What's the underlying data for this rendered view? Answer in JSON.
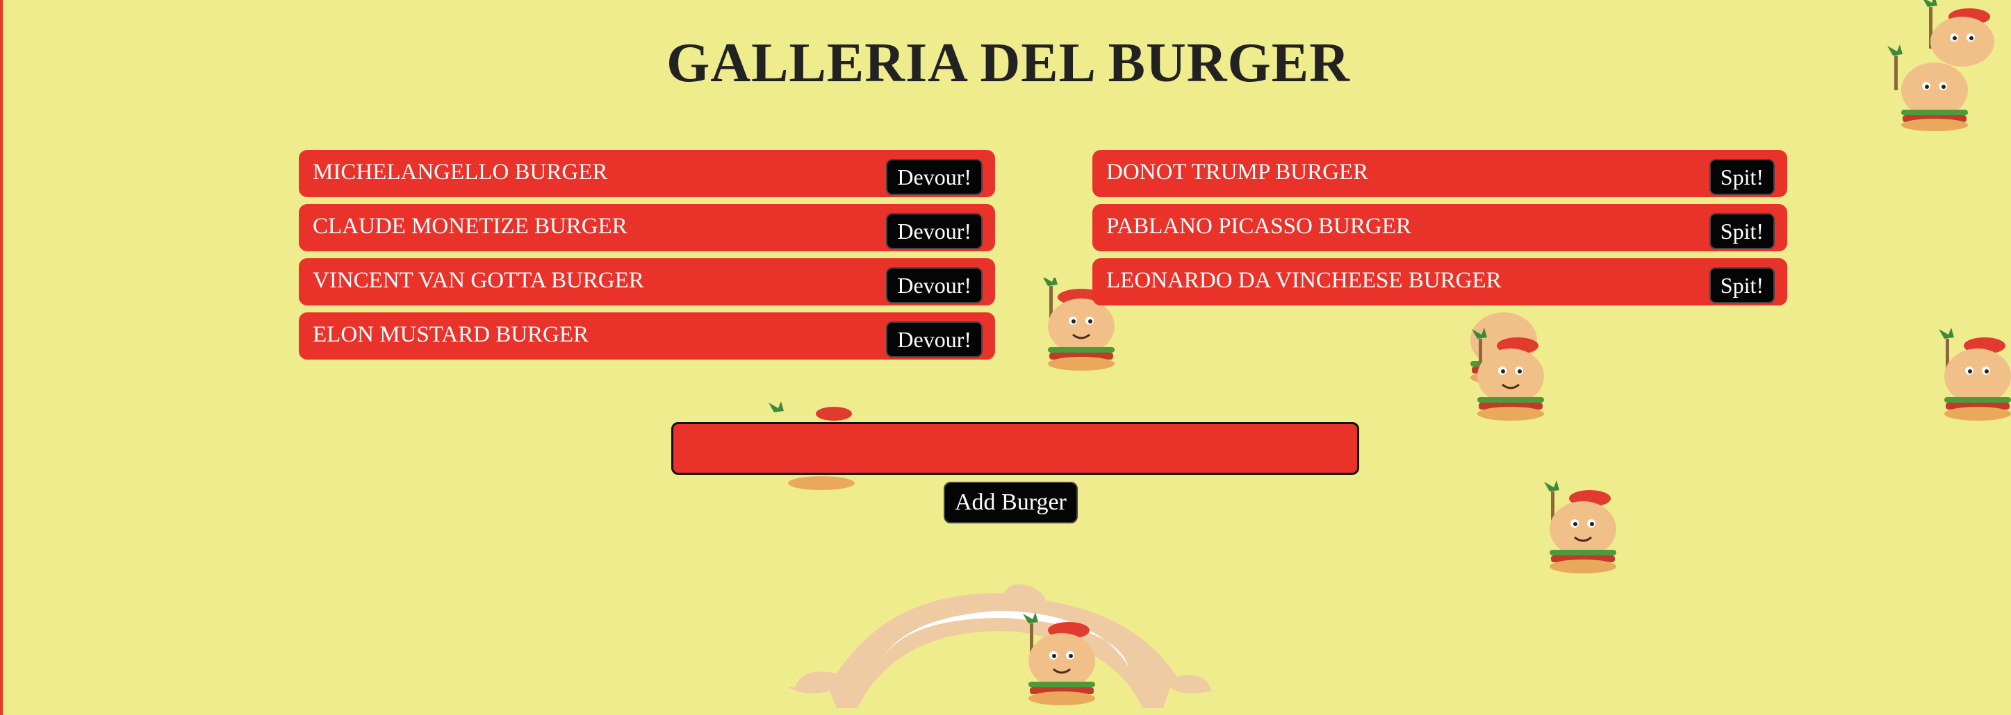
{
  "page": {
    "title": "GALLERIA DEL BURGER"
  },
  "uneaten": [
    {
      "name": "MICHELANGELLO BURGER",
      "button": "Devour!"
    },
    {
      "name": "CLAUDE MONETIZE BURGER",
      "button": "Devour!"
    },
    {
      "name": "VINCENT VAN GOTTA BURGER",
      "button": "Devour!"
    },
    {
      "name": "ELON MUSTARD BURGER",
      "button": "Devour!"
    }
  ],
  "devoured": [
    {
      "name": "DONOT TRUMP BURGER",
      "button": "Spit!"
    },
    {
      "name": "PABLANO PICASSO BURGER",
      "button": "Spit!"
    },
    {
      "name": "LEONARDO DA VINCHEESE BURGER",
      "button": "Spit!"
    }
  ],
  "form": {
    "input_value": "",
    "input_placeholder": "",
    "submit_label": "Add Burger"
  },
  "colors": {
    "background": "#efec8d",
    "row": "#e8322a",
    "button": "#050505",
    "title": "#222222"
  },
  "icons": [
    "burger-artist-mascot-icon",
    "giant-mouth-icon"
  ]
}
